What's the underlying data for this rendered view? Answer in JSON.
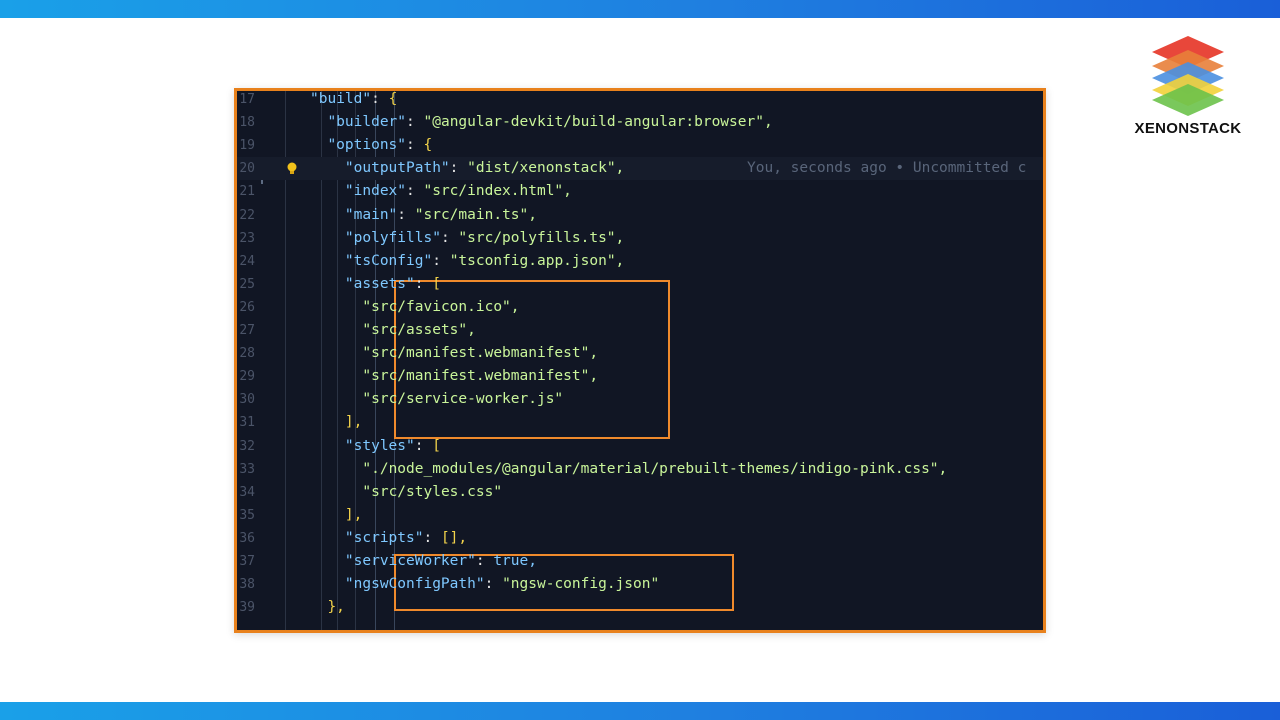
{
  "brand": {
    "name": "XENONSTACK",
    "colors": {
      "accent_bar": "#1f7fe0",
      "highlight_border": "#e8811c"
    }
  },
  "editor": {
    "blame": "You, seconds ago • Uncommitted c",
    "lines": [
      {
        "num": "17",
        "key": "\"build\"",
        "value": "{",
        "indent": 7
      },
      {
        "num": "18",
        "key": "\"builder\"",
        "value": "\"@angular-devkit/build-angular:browser\",",
        "indent": 8
      },
      {
        "num": "19",
        "key": "\"options\"",
        "value": "{",
        "indent": 8
      },
      {
        "num": "20",
        "key": "\"outputPath\"",
        "value": "\"dist/xenonstack\",",
        "indent": 9
      },
      {
        "num": "21",
        "key": "\"index\"",
        "value": "\"src/index.html\",",
        "indent": 9
      },
      {
        "num": "22",
        "key": "\"main\"",
        "value": "\"src/main.ts\",",
        "indent": 9
      },
      {
        "num": "23",
        "key": "\"polyfills\"",
        "value": "\"src/polyfills.ts\",",
        "indent": 9
      },
      {
        "num": "24",
        "key": "\"tsConfig\"",
        "value": "\"tsconfig.app.json\",",
        "indent": 9
      },
      {
        "num": "25",
        "key": "\"assets\"",
        "value": "[",
        "indent": 9
      },
      {
        "num": "26",
        "key": "",
        "value": "\"src/favicon.ico\",",
        "indent": 10
      },
      {
        "num": "27",
        "key": "",
        "value": "\"src/assets\",",
        "indent": 10
      },
      {
        "num": "28",
        "key": "",
        "value": "\"src/manifest.webmanifest\",",
        "indent": 10
      },
      {
        "num": "29",
        "key": "",
        "value": "\"src/manifest.webmanifest\",",
        "indent": 10
      },
      {
        "num": "30",
        "key": "",
        "value": "\"src/service-worker.js\"",
        "indent": 10
      },
      {
        "num": "31",
        "key": "",
        "value": "],",
        "indent": 9
      },
      {
        "num": "32",
        "key": "\"styles\"",
        "value": "[",
        "indent": 9
      },
      {
        "num": "33",
        "key": "",
        "value": "\"./node_modules/@angular/material/prebuilt-themes/indigo-pink.css\",",
        "indent": 10
      },
      {
        "num": "34",
        "key": "",
        "value": "\"src/styles.css\"",
        "indent": 10
      },
      {
        "num": "35",
        "key": "",
        "value": "],",
        "indent": 9
      },
      {
        "num": "36",
        "key": "\"scripts\"",
        "value": "[],",
        "indent": 9
      },
      {
        "num": "37",
        "key": "\"serviceWorker\"",
        "value": "true,",
        "indent": 9
      },
      {
        "num": "38",
        "key": "\"ngswConfigPath\"",
        "value": "\"ngsw-config.json\"",
        "indent": 9
      },
      {
        "num": "39",
        "key": "",
        "value": "},",
        "indent": 8
      }
    ]
  }
}
